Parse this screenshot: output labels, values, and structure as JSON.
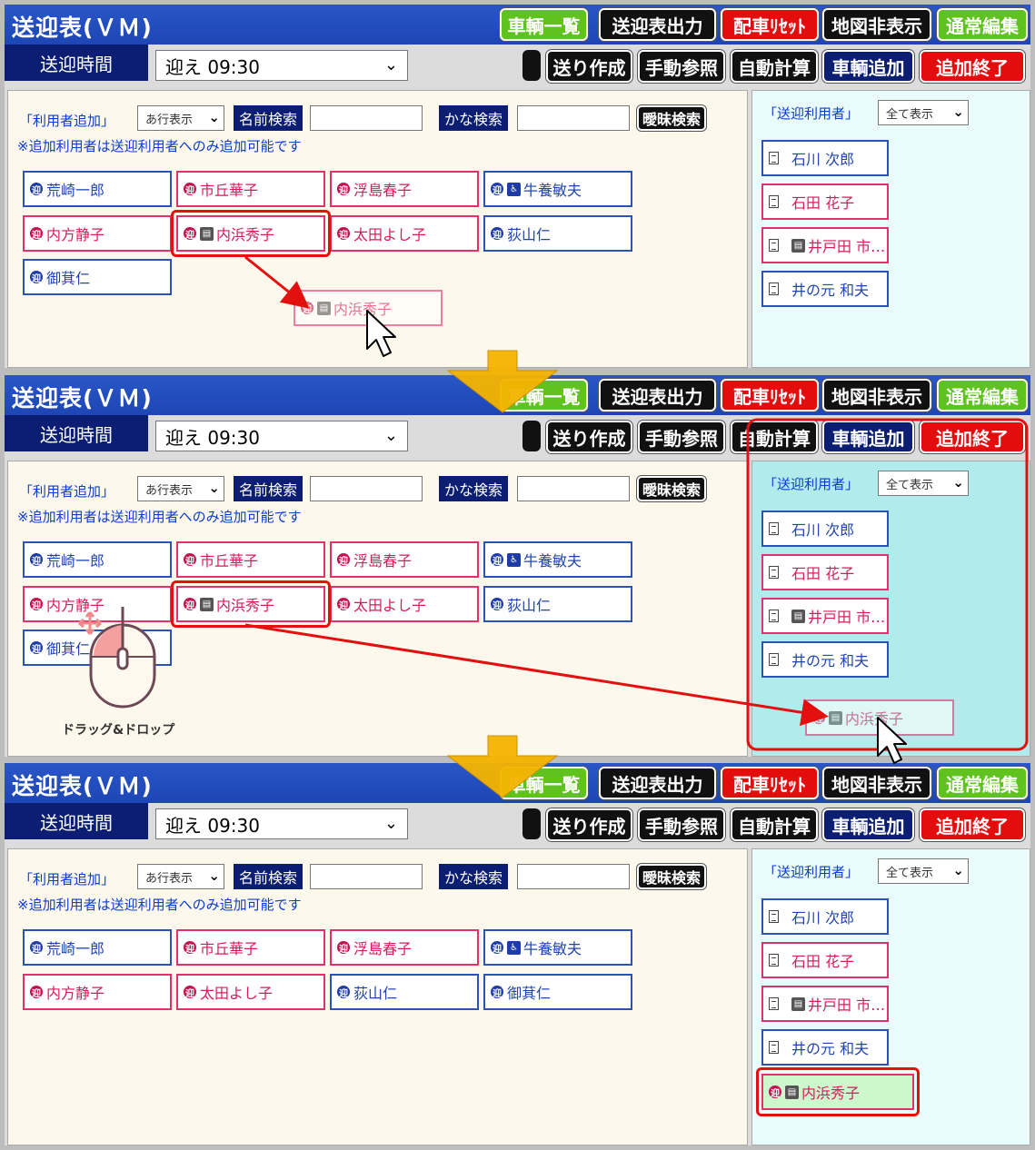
{
  "app": {
    "title": "送迎表(ＶＭ)",
    "buttons": {
      "vehicle_list": "車輌一覧",
      "output": "送迎表出力",
      "reset": "配車ﾘｾｯﾄ",
      "hide_map": "地図非表示",
      "normal_edit": "通常編集",
      "send_create": "送り作成",
      "manual_ref": "手動参照",
      "auto_calc": "自動計算",
      "add_vehicle": "車輌追加",
      "finish_add": "追加終了"
    },
    "time_label": "送迎時間",
    "time_value": "迎え 09:30",
    "add_user_label": "「利用者追加」",
    "row_filter": "あ行表示",
    "name_search": "名前検索",
    "kana_search": "かな検索",
    "fuzzy_search": "曖昧検索",
    "note": "※追加利用者は送迎利用者へのみ追加可能です",
    "pickup_users_label": "「送迎利用者」",
    "show_all": "全て表示"
  },
  "colors": {
    "male": "#2b53b7",
    "female": "#e2306d",
    "title_blue": "#1d46b4",
    "navy": "#0b1e72",
    "red": "#e30d0d",
    "green": "#5fc21f",
    "highlight": "#e31010",
    "arrow_gold": "#f5b400"
  },
  "users": {
    "arasaki": {
      "name": "荒崎一郎",
      "sex": "m",
      "badge": "迎",
      "icon": ""
    },
    "ichioka": {
      "name": "市丘華子",
      "sex": "f",
      "badge": "迎",
      "icon": ""
    },
    "ukishima": {
      "name": "浮島春子",
      "sex": "f",
      "badge": "迎",
      "icon": ""
    },
    "ushikai": {
      "name": "牛養敏夫",
      "sex": "m",
      "badge": "迎",
      "icon": "wheelchair-icon"
    },
    "uchikata": {
      "name": "内方静子",
      "sex": "f",
      "badge": "迎",
      "icon": ""
    },
    "uchihama": {
      "name": "内浜秀子",
      "sex": "f",
      "badge": "迎",
      "icon": "vehicle-icon"
    },
    "ota": {
      "name": "太田よし子",
      "sex": "f",
      "badge": "迎",
      "icon": ""
    },
    "ogiyama": {
      "name": "荻山仁",
      "sex": "m",
      "badge": "迎",
      "icon": ""
    },
    "mikuri": {
      "name": "御萁仁",
      "sex": "m",
      "badge": "迎",
      "icon": ""
    }
  },
  "pickup_users": [
    {
      "name": "石川 次郎",
      "sex": "m",
      "icon": ""
    },
    {
      "name": "石田 花子",
      "sex": "f",
      "icon": ""
    },
    {
      "name": "井戸田 市…",
      "sex": "f",
      "icon": "vehicle-icon"
    },
    {
      "name": "井の元 和夫",
      "sex": "m",
      "icon": ""
    }
  ],
  "steps": [
    {
      "step": 1,
      "layout": [
        "arasaki",
        "ichioka",
        "ukishima",
        "ushikai",
        "uchikata",
        "uchihama",
        "ota",
        "ogiyama",
        "mikuri"
      ],
      "highlight": "uchihama",
      "added": null,
      "drop_highlight": false
    },
    {
      "step": 2,
      "layout": [
        "arasaki",
        "ichioka",
        "ukishima",
        "ushikai",
        "uchikata",
        "uchihama",
        "ota",
        "ogiyama",
        "mikuri"
      ],
      "highlight": "uchihama",
      "added": null,
      "drop_highlight": true
    },
    {
      "step": 3,
      "layout": [
        "arasaki",
        "ichioka",
        "ukishima",
        "ushikai",
        "uchikata",
        "ota",
        "ogiyama",
        "mikuri"
      ],
      "highlight": null,
      "added": "uchihama",
      "drop_highlight": false
    }
  ],
  "drag_drop_caption": "ドラッグ&ドロップ"
}
